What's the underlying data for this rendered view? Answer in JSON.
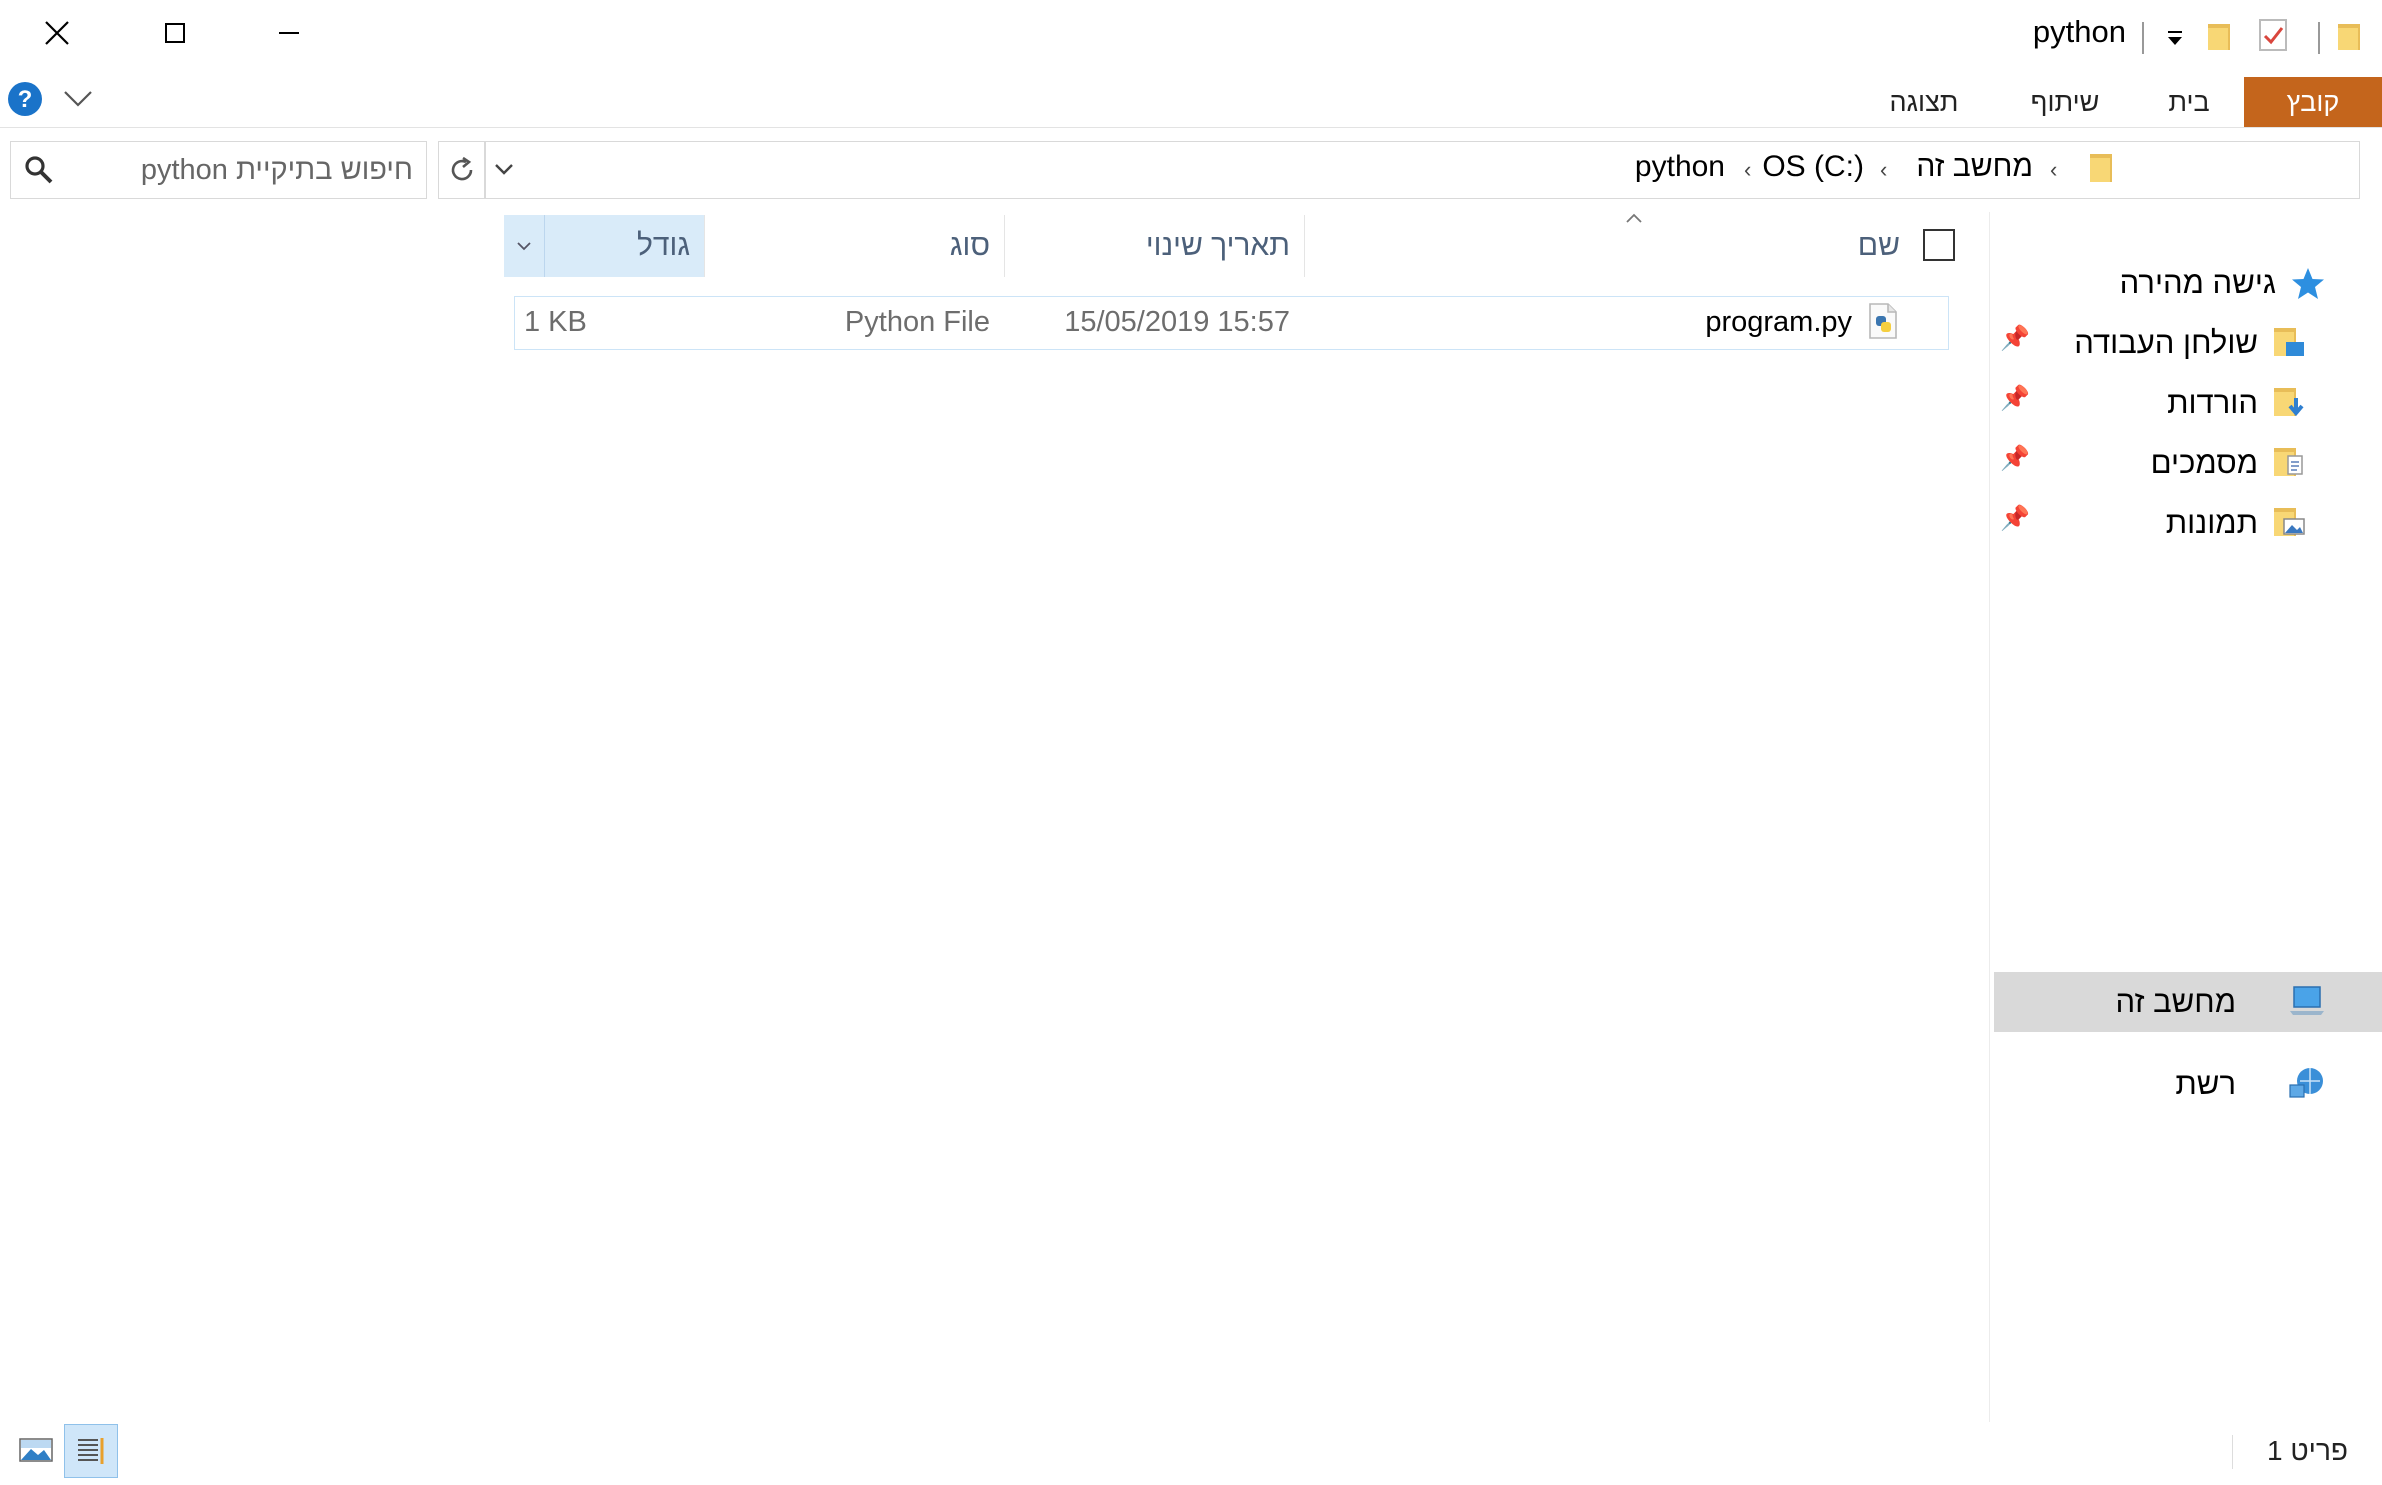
{
  "window": {
    "title": "python",
    "controls": {
      "close": "close",
      "maximize": "maximize",
      "minimize": "minimize"
    }
  },
  "quick_access_toolbar": {
    "icons": [
      "folder-icon",
      "properties-icon",
      "folder-icon",
      "customize-dropdown-icon"
    ]
  },
  "ribbon": {
    "tabs": [
      {
        "id": "file",
        "label": "קובץ"
      },
      {
        "id": "home",
        "label": "בית"
      },
      {
        "id": "share",
        "label": "שיתוף"
      },
      {
        "id": "view",
        "label": "תצוגה"
      }
    ],
    "help_icon": "?"
  },
  "address_bar": {
    "breadcrumbs": [
      "מחשב זה",
      "OS (C:)",
      "python"
    ]
  },
  "search": {
    "placeholder": "חיפוש בתיקיית python"
  },
  "columns": {
    "name": "שם",
    "date_modified": "תאריך שינוי",
    "type": "סוג",
    "size": "גודל"
  },
  "files": [
    {
      "name": "program.py",
      "date_modified": "15/05/2019 15:57",
      "type": "Python File",
      "size": "1 KB"
    }
  ],
  "navigation": {
    "quick_access": {
      "label": "גישה מהירה",
      "items": [
        {
          "label": "שולחן העבודה",
          "icon": "desktop-folder-icon"
        },
        {
          "label": "הורדות",
          "icon": "downloads-folder-icon"
        },
        {
          "label": "מסמכים",
          "icon": "documents-folder-icon"
        },
        {
          "label": "תמונות",
          "icon": "pictures-folder-icon"
        }
      ]
    },
    "this_pc": {
      "label": "מחשב זה",
      "selected": true
    },
    "network": {
      "label": "רשת"
    }
  },
  "status_bar": {
    "item_count": "פריט 1"
  },
  "colors": {
    "file_tab": "#c4651c",
    "selected_header": "#d9ebf9",
    "selected_nav": "#d9d9d9"
  }
}
